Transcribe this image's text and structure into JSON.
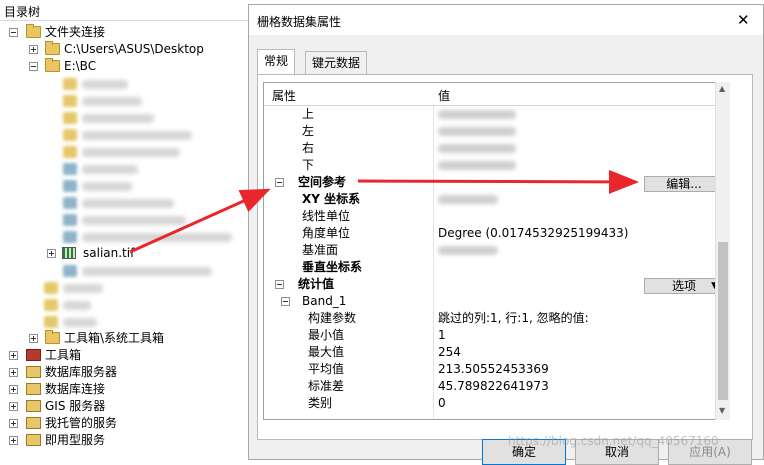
{
  "catalog": {
    "title": "目录树",
    "items": {
      "folder_connections": "文件夹连接",
      "desktop": "C:\\Users\\ASUS\\Desktop",
      "ebc": "E:\\BC",
      "salian": "salian.tif",
      "toolbox_folder": "工具箱\\系统工具箱",
      "toolbox": "工具箱",
      "db_servers": "数据库服务器",
      "db_connections": "数据库连接",
      "gis_servers": "GIS 服务器",
      "hosted_services": "我托管的服务",
      "ready_services": "即用型服务"
    }
  },
  "dialog": {
    "title": "栅格数据集属性",
    "close_glyph": "✕",
    "tabs": [
      "常规",
      "键元数据"
    ],
    "columns": {
      "property": "属性",
      "value": "值"
    },
    "extent": {
      "top": "上",
      "left": "左",
      "right": "右",
      "bottom": "下"
    },
    "spatial_ref": {
      "section": "空间参考",
      "edit_button": "编辑...",
      "xy": "XY 坐标系",
      "linear_unit": "线性单位",
      "angular_unit": "角度单位",
      "angular_unit_value": "Degree (0.0174532925199433)",
      "datum": "基准面",
      "vertical": "垂直坐标系"
    },
    "statistics": {
      "section": "统计值",
      "options_button": "选项",
      "band": "Band_1",
      "rows": [
        {
          "key": "构建参数",
          "value": "跳过的列:1, 行:1, 忽略的值:"
        },
        {
          "key": "最小值",
          "value": "1"
        },
        {
          "key": "最大值",
          "value": "254"
        },
        {
          "key": "平均值",
          "value": "213.50552453369"
        },
        {
          "key": "标准差",
          "value": "45.789822641973"
        },
        {
          "key": "类别",
          "value": "0"
        }
      ]
    },
    "buttons": {
      "ok": "确定",
      "cancel": "取消",
      "apply": "应用(A)"
    }
  },
  "watermark": "https://blog.csdn.net/qq_40567160",
  "colors": {
    "arrow": "#e8262b",
    "selection": "#cce4f7"
  }
}
